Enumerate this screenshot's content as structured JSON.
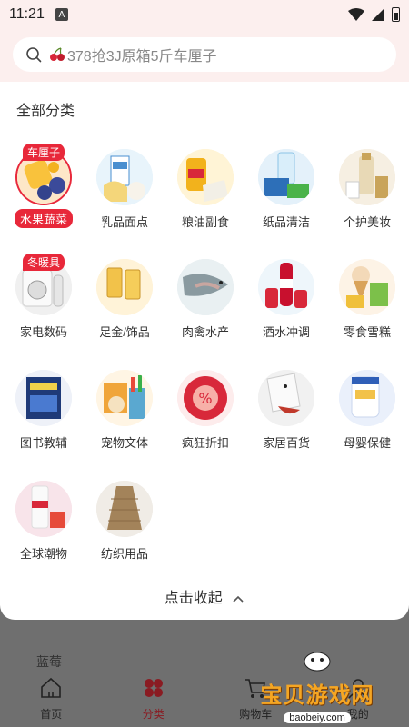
{
  "status": {
    "time": "11:21",
    "a_badge": "A"
  },
  "search": {
    "placeholder": "378抢3J原箱5斤车厘子"
  },
  "section_title": "全部分类",
  "categories": [
    {
      "label": "水果蔬菜",
      "badge": "车厘子",
      "active": true
    },
    {
      "label": "乳品面点"
    },
    {
      "label": "粮油副食"
    },
    {
      "label": "纸品清洁"
    },
    {
      "label": "个护美妆"
    },
    {
      "label": "家电数码",
      "badge": "冬暖具"
    },
    {
      "label": "足金/饰品"
    },
    {
      "label": "肉禽水产"
    },
    {
      "label": "酒水冲调"
    },
    {
      "label": "零食雪糕"
    },
    {
      "label": "图书教辅"
    },
    {
      "label": "宠物文体"
    },
    {
      "label": "疯狂折扣"
    },
    {
      "label": "家居百货"
    },
    {
      "label": "母婴保健"
    },
    {
      "label": "全球潮物"
    },
    {
      "label": "纺织用品"
    }
  ],
  "collapse_label": "点击收起",
  "behind_text": "蓝莓",
  "nav": [
    {
      "label": "首页"
    },
    {
      "label": "分类"
    },
    {
      "label": "购物车"
    },
    {
      "label": "我的"
    }
  ],
  "watermark": {
    "title": "宝贝游戏网",
    "url": "baobeiy.com"
  },
  "colors": {
    "accent": "#e8283a",
    "nav_active": "#8a1b22",
    "header_bg": "#fcefee"
  }
}
